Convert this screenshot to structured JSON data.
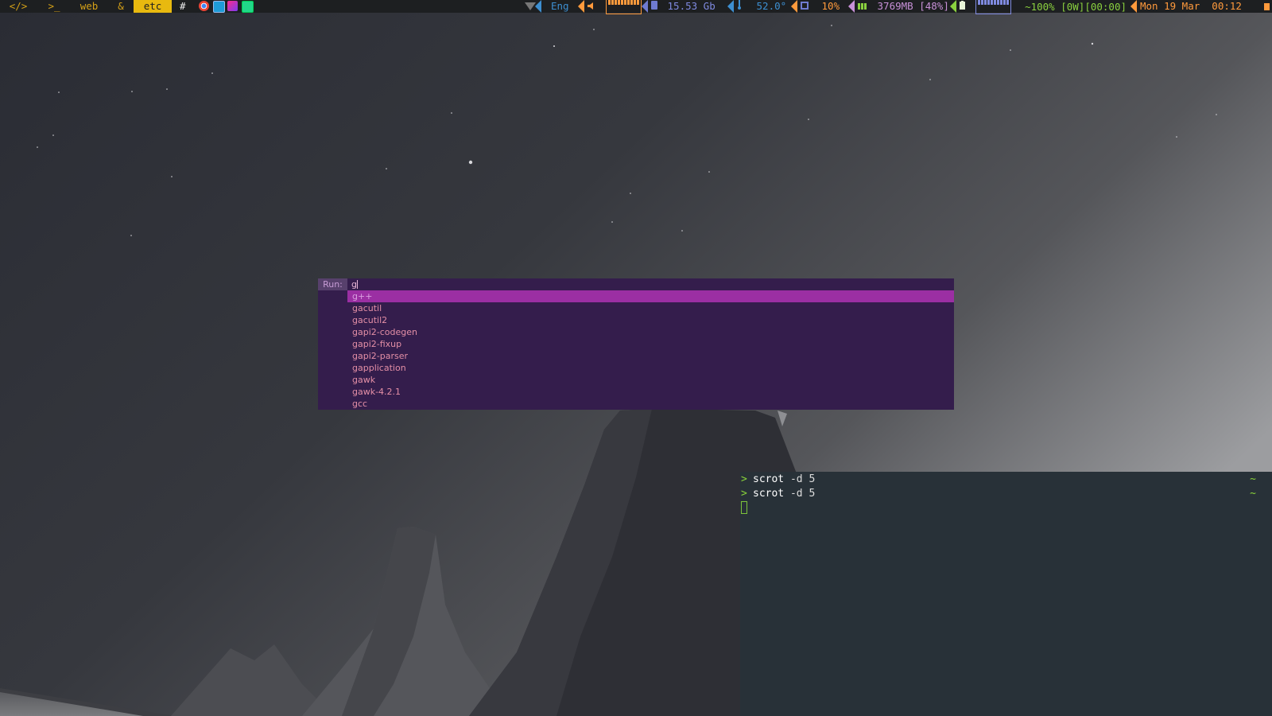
{
  "topbar": {
    "workspaces": [
      {
        "label": "</>",
        "active": false
      },
      {
        "label": ">_",
        "active": false
      },
      {
        "label": "web",
        "active": false
      },
      {
        "label": "&",
        "active": false
      },
      {
        "label": "etc",
        "active": true
      }
    ],
    "layout_symbol": "#",
    "tray_icons": [
      "chrome-icon",
      "browser-icon",
      "intellij-icon",
      "android-studio-icon"
    ],
    "status": {
      "keyboard_layout": "Eng",
      "volume_level": 1.0,
      "disk_free": "15.53 Gb",
      "temperature": "52.0°",
      "cpu": "10%",
      "memory": "3769MB [48%]",
      "battery_level": 1.0,
      "battery_text": "~100% [0W][00:00]",
      "datetime": "Mon 19 Mar  00:12"
    },
    "colors": {
      "keyboard": "#3d8fd1",
      "volume": "#ff9a3c",
      "disk": "#6f7bd0",
      "temperature": "#3d8fd1",
      "cpu": "#ff9a3c",
      "memory": "#c891d8",
      "battery": "#8ad13f",
      "clock": "#ff9a3c"
    }
  },
  "runner": {
    "label": "Run:",
    "query": "g",
    "items": [
      "g++",
      "gacutil",
      "gacutil2",
      "gapi2-codegen",
      "gapi2-fixup",
      "gapi2-parser",
      "gapplication",
      "gawk",
      "gawk-4.2.1",
      "gcc"
    ],
    "selected_index": 0
  },
  "terminal": {
    "lines": [
      {
        "prompt": ">",
        "command": "scrot",
        "args": " -d 5",
        "cwd": "~"
      },
      {
        "prompt": ">",
        "command": "scrot",
        "args": " -d 5",
        "cwd": "~"
      }
    ]
  }
}
